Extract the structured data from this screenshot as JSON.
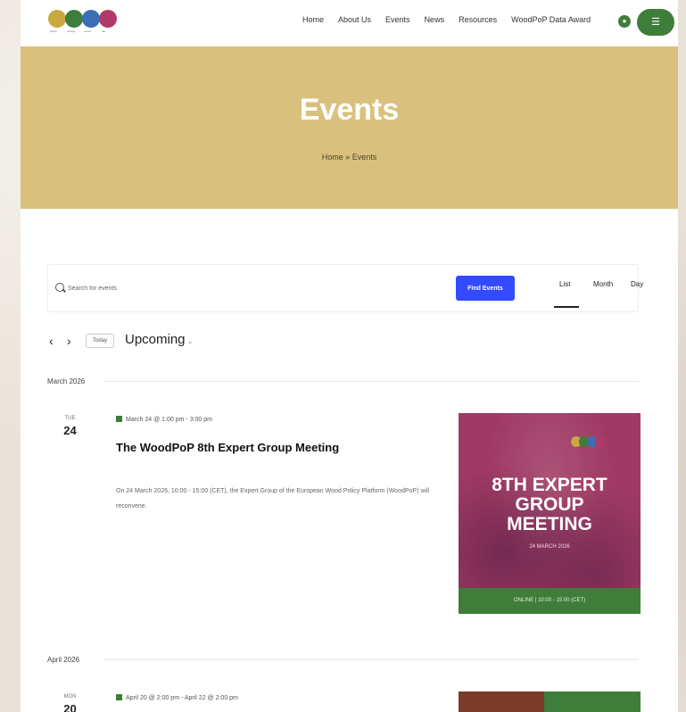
{
  "header": {
    "logo_caption": [
      "forest",
      "europe",
      "unece",
      "fao"
    ],
    "nav": [
      "Home",
      "About Us",
      "Events",
      "News",
      "Resources",
      "WoodPoP Data Award"
    ],
    "menu_icon": "hamburger-icon",
    "nav_icon": "search-icon"
  },
  "hero": {
    "title": "Events",
    "breadcrumb": "Home » Events"
  },
  "search": {
    "placeholder": "Search for events",
    "button": "Find Events",
    "views": [
      "List",
      "Month",
      "Day"
    ],
    "active_view": "List"
  },
  "controls": {
    "prev": "‹",
    "next": "›",
    "today": "Today",
    "upcoming": "Upcoming"
  },
  "groups": [
    {
      "month": "March 2026",
      "event": {
        "dow": "TUE",
        "day": "24",
        "date": "March 24 @ 1:00 pm - 3:00 pm",
        "title": "The WoodPoP 8th Expert Group Meeting",
        "description": "On 24 March 2026, 10:00 - 15:00 (CET), the Expert Group of the European Wood Policy Platform (WoodPoP) will reconvene.",
        "image": {
          "headline_1": "8TH EXPERT",
          "headline_2": "GROUP",
          "headline_3": "MEETING",
          "subtitle": "24 MARCH 2026",
          "footer": "ONLINE | 10:00 - 15:00 (CET)"
        }
      }
    },
    {
      "month": "April 2026",
      "event": {
        "dow": "MON",
        "day": "20",
        "date": "April 20 @ 2:00 pm - April 22 @ 2:00 pm"
      }
    }
  ],
  "colors": {
    "hero": "#d9c17d",
    "accent_green": "#3e7d3a",
    "button_blue": "#334aff",
    "event_image": "#a03a63"
  }
}
